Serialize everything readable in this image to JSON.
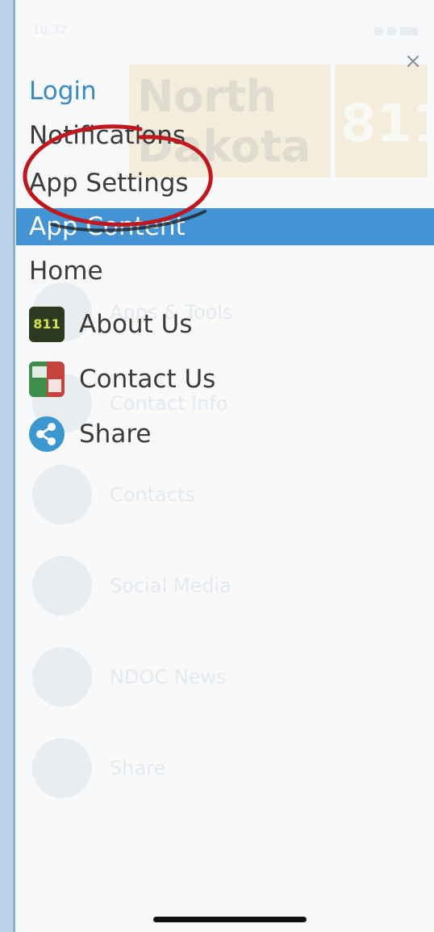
{
  "status_bar": {
    "time": "10:32"
  },
  "close_label": "×",
  "menu": {
    "login": "Login",
    "notifications": "Notifications",
    "app_settings": "App Settings",
    "section_header": "App Content",
    "home": "Home",
    "items": [
      {
        "label": "About Us",
        "icon": "811-app-icon"
      },
      {
        "label": "Contact Us",
        "icon": "contact-card-icon"
      },
      {
        "label": "Share",
        "icon": "share-icon"
      }
    ]
  },
  "background_logo": {
    "line1": "North",
    "line2": "Dakota",
    "badge": "811"
  },
  "background_items": [
    {
      "label": "Apps & Tools"
    },
    {
      "label": "Contact Info"
    },
    {
      "label": "Contacts"
    },
    {
      "label": "Social Media"
    },
    {
      "label": "NDOC News"
    },
    {
      "label": "Share"
    }
  ],
  "colors": {
    "accent": "#4393d5",
    "login_text": "#3a88c4",
    "annotation": "#c0171d"
  }
}
